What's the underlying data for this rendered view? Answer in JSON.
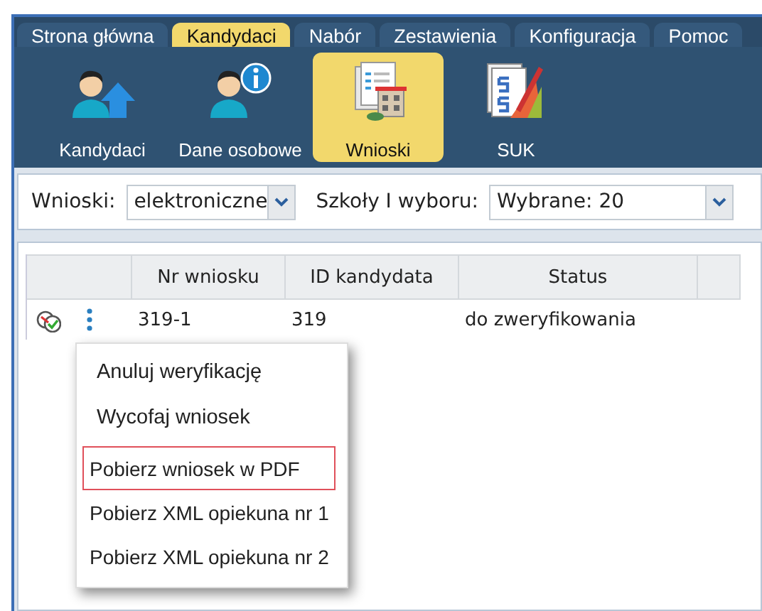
{
  "tabs": [
    {
      "label": "Strona główna",
      "selected": false
    },
    {
      "label": "Kandydaci",
      "selected": true
    },
    {
      "label": "Nabór",
      "selected": false
    },
    {
      "label": "Zestawienia",
      "selected": false
    },
    {
      "label": "Konfiguracja",
      "selected": false
    },
    {
      "label": "Pomoc",
      "selected": false
    }
  ],
  "ribbon": [
    {
      "label": "Kandydaci",
      "kind": "person-upload",
      "selected": false
    },
    {
      "label": "Dane osobowe",
      "kind": "person-info",
      "selected": false
    },
    {
      "label": "Wnioski",
      "kind": "documents",
      "selected": true
    },
    {
      "label": "SUK",
      "kind": "grades",
      "selected": false
    }
  ],
  "filters": [
    {
      "label": "Wnioski:",
      "value": "elektroniczne"
    },
    {
      "label": "Szkoły I wyboru:",
      "value": "Wybrane: 20"
    }
  ],
  "table": {
    "columns": [
      "Nr wniosku",
      "ID kandydata",
      "Status"
    ],
    "rows": [
      {
        "cells": [
          "319-1",
          "319",
          "do zweryfikowania"
        ]
      }
    ]
  },
  "context_menu": {
    "groups": [
      {
        "items": [
          {
            "label": "Anuluj weryfikację",
            "highlighted": false
          },
          {
            "label": "Wycofaj wniosek",
            "highlighted": false
          }
        ]
      },
      {
        "items": [
          {
            "label": "Pobierz wniosek w PDF",
            "highlighted": true
          },
          {
            "label": "Pobierz XML opiekuna nr 1",
            "highlighted": false
          },
          {
            "label": "Pobierz XML opiekuna nr 2",
            "highlighted": false
          }
        ]
      }
    ]
  }
}
